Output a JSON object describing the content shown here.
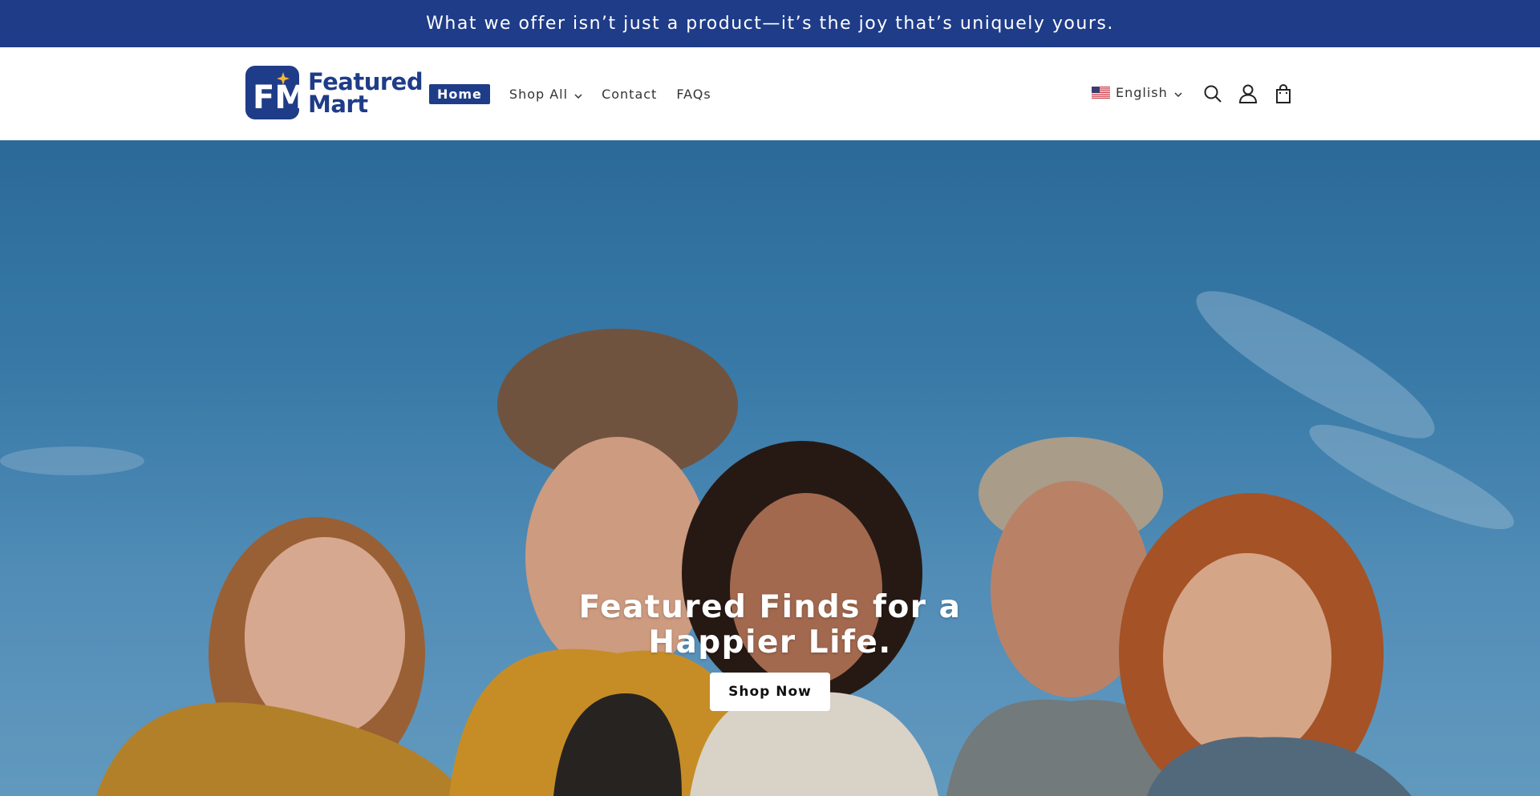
{
  "announcement": {
    "text": "What we offer isn’t just a product—it’s the joy that’s uniquely yours."
  },
  "header": {
    "logo": {
      "line1": "Featured",
      "line2": "Mart",
      "mark_letters": "FM"
    },
    "nav": [
      {
        "label": "Home",
        "active": true
      },
      {
        "label": "Shop All",
        "has_dropdown": true
      },
      {
        "label": "Contact"
      },
      {
        "label": "FAQs"
      }
    ],
    "language": {
      "label": "English",
      "flag": "us-flag-icon"
    },
    "icons": [
      "search-icon",
      "account-icon",
      "cart-icon"
    ]
  },
  "hero": {
    "title": "Featured Finds for a Happier Life.",
    "button_label": "Shop Now"
  },
  "colors": {
    "brand": "#1f3c88",
    "announcement_bg": "#1f3c88",
    "button_bg": "#ffffff",
    "sky": "#3d84b6"
  }
}
